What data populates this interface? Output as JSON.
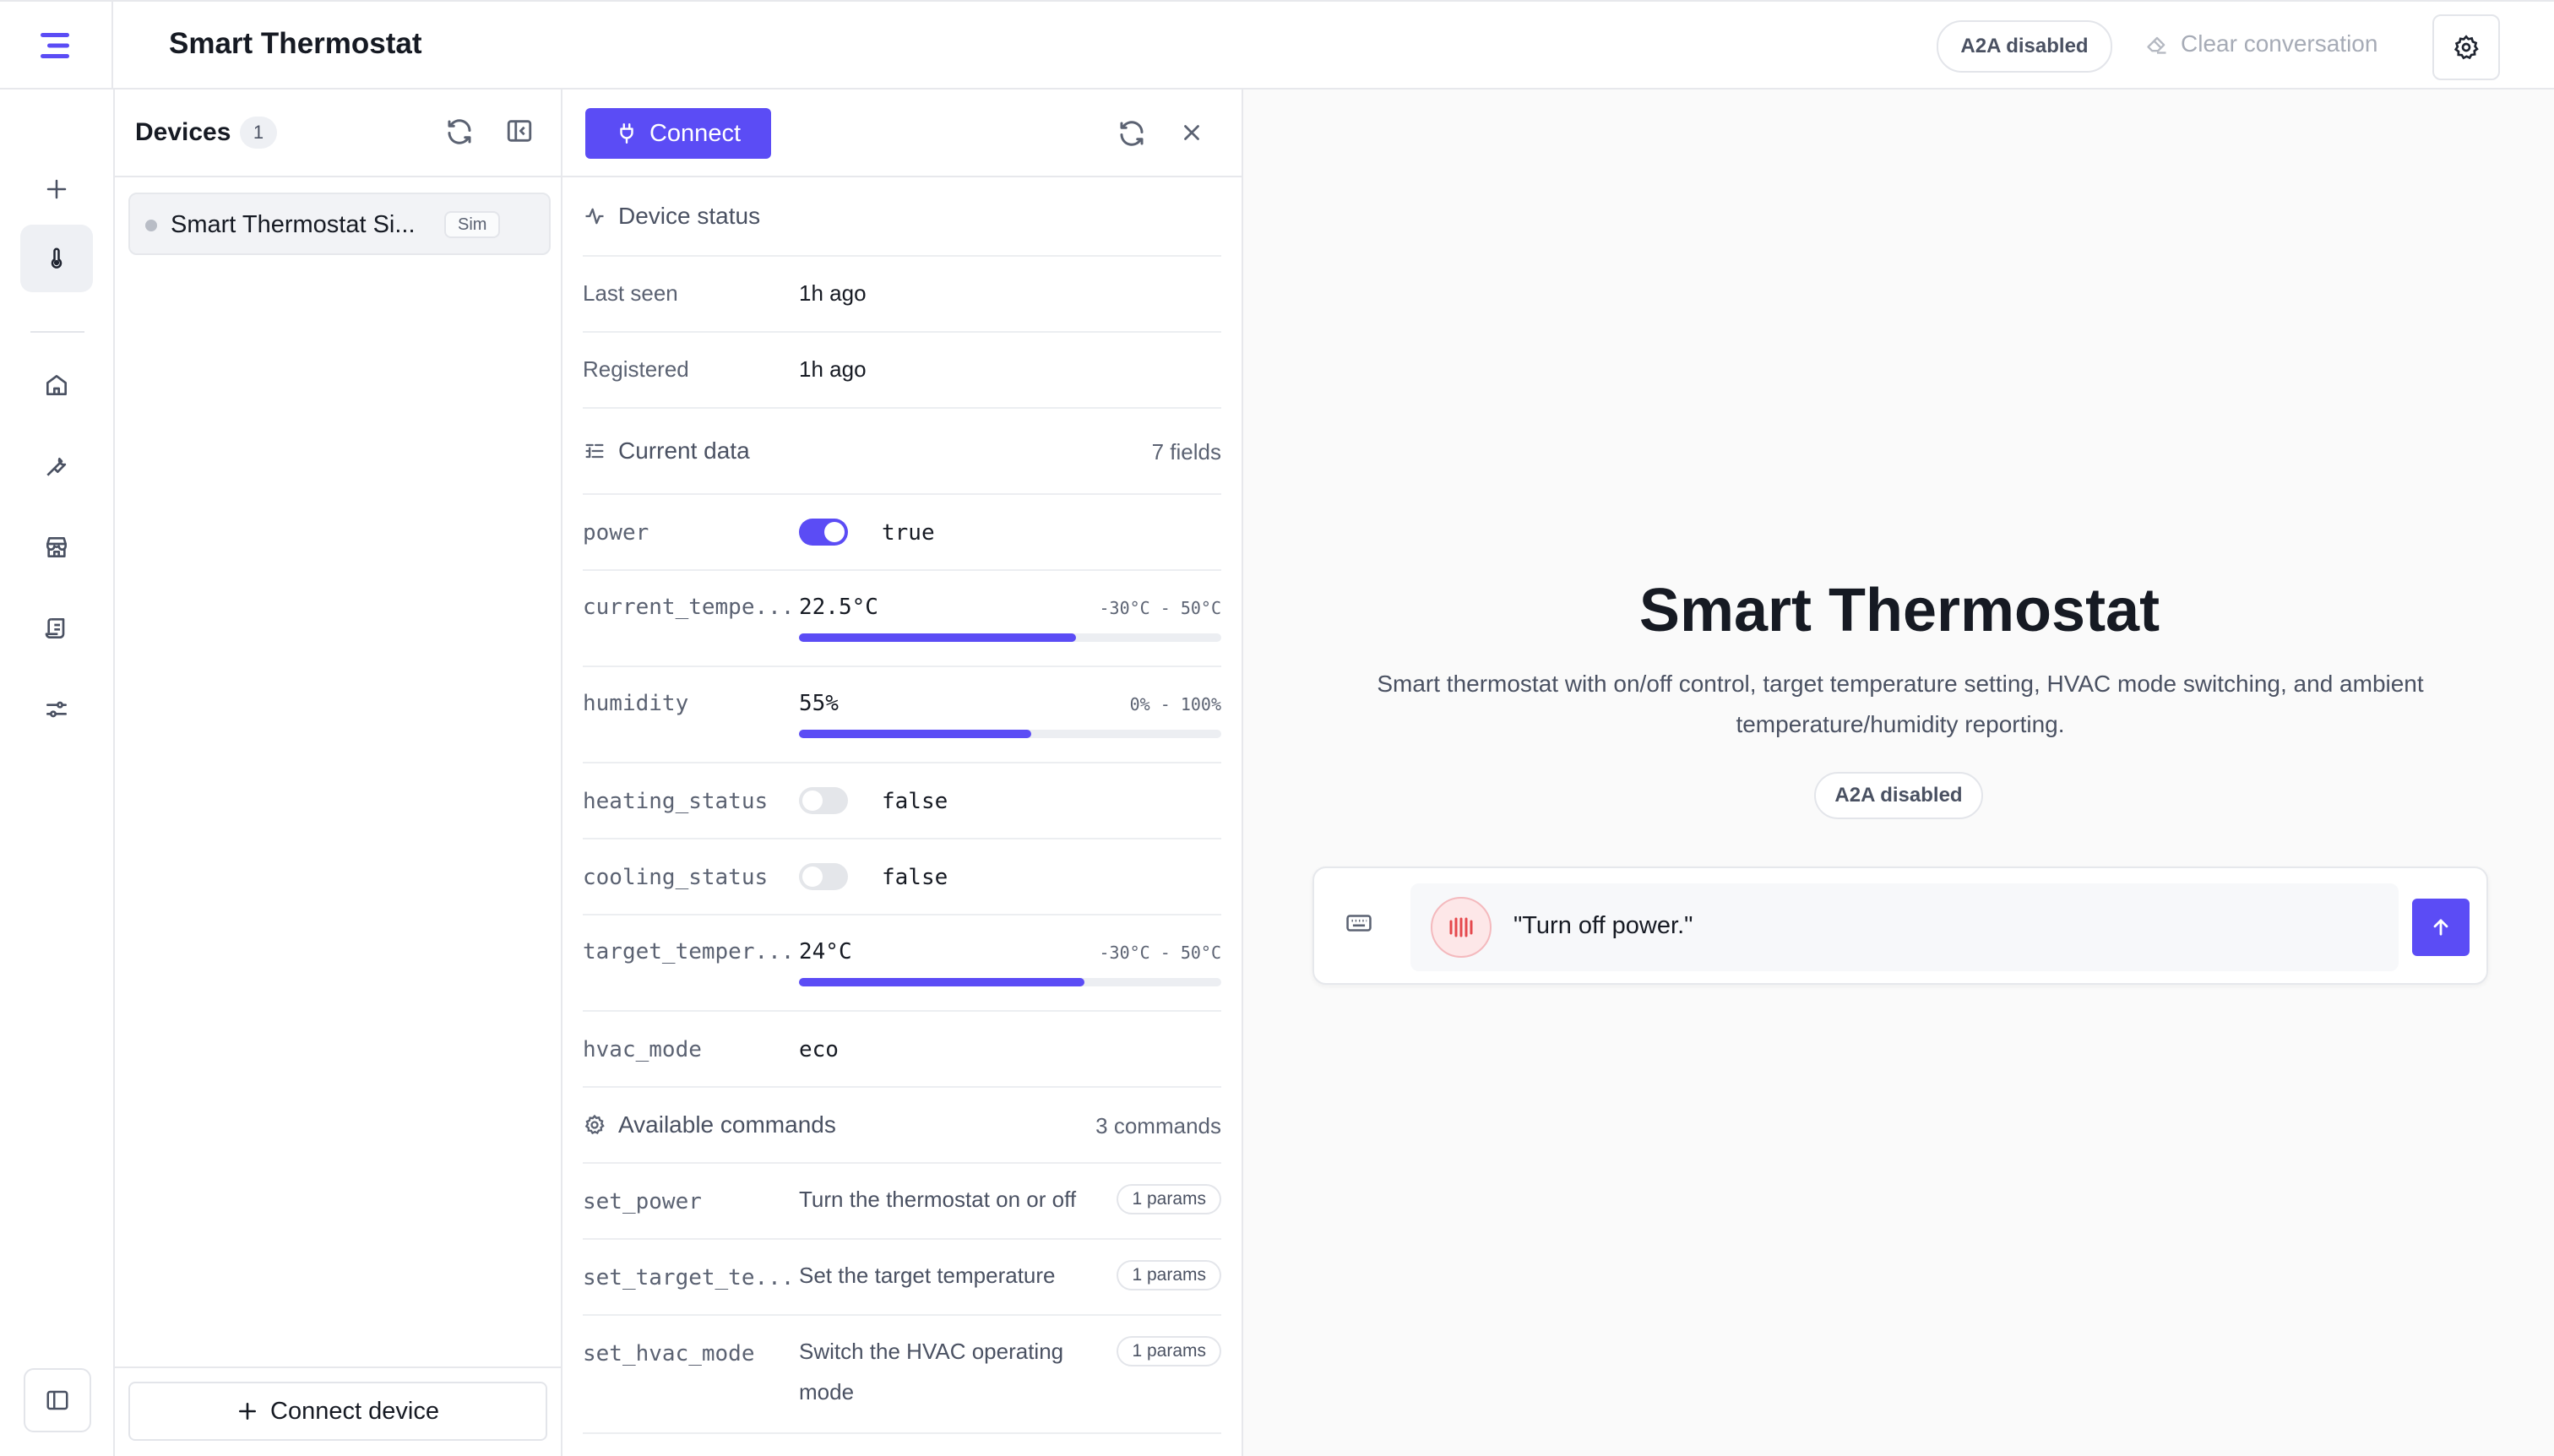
{
  "header": {
    "title": "Smart Thermostat",
    "a2a_label": "A2A disabled",
    "clear_label": "Clear conversation"
  },
  "devices": {
    "label": "Devices",
    "count": "1",
    "items": [
      {
        "name": "Smart Thermostat Si...",
        "badge": "Sim"
      }
    ],
    "connect_label": "Connect device"
  },
  "detail": {
    "connect_label": "Connect",
    "status": {
      "title": "Device status",
      "rows": [
        {
          "key": "Last seen",
          "value": "1h ago"
        },
        {
          "key": "Registered",
          "value": "1h ago"
        }
      ]
    },
    "current": {
      "title": "Current data",
      "count_label": "7 fields",
      "power": {
        "key": "power",
        "value": "true",
        "on": true
      },
      "current_temp": {
        "key": "current_tempe...",
        "value": "22.5°C",
        "range": "-30°C - 50°C",
        "fraction": 0.656
      },
      "humidity": {
        "key": "humidity",
        "value": "55%",
        "range": "0% - 100%",
        "fraction": 0.55
      },
      "heating": {
        "key": "heating_status",
        "value": "false",
        "on": false
      },
      "cooling": {
        "key": "cooling_status",
        "value": "false",
        "on": false
      },
      "target_temp": {
        "key": "target_temper...",
        "value": "24°C",
        "range": "-30°C - 50°C",
        "fraction": 0.675
      },
      "hvac": {
        "key": "hvac_mode",
        "value": "eco"
      }
    },
    "commands": {
      "title": "Available commands",
      "count_label": "3 commands",
      "items": [
        {
          "name": "set_power",
          "desc": "Turn the thermostat on or off",
          "params": "1 params"
        },
        {
          "name": "set_target_te...",
          "desc": "Set the target temperature",
          "params": "1 params"
        },
        {
          "name": "set_hvac_mode",
          "desc": "Switch the HVAC operating mode",
          "params": "1 params"
        }
      ]
    }
  },
  "main": {
    "title": "Smart Thermostat",
    "description": "Smart thermostat with on/off control, target temperature setting, HVAC mode switching, and ambient temperature/humidity reporting.",
    "a2a_label": "A2A disabled",
    "message": "\"Turn off power.\""
  },
  "colors": {
    "accent": "#5b4cf5",
    "mic": "#e5484d"
  }
}
